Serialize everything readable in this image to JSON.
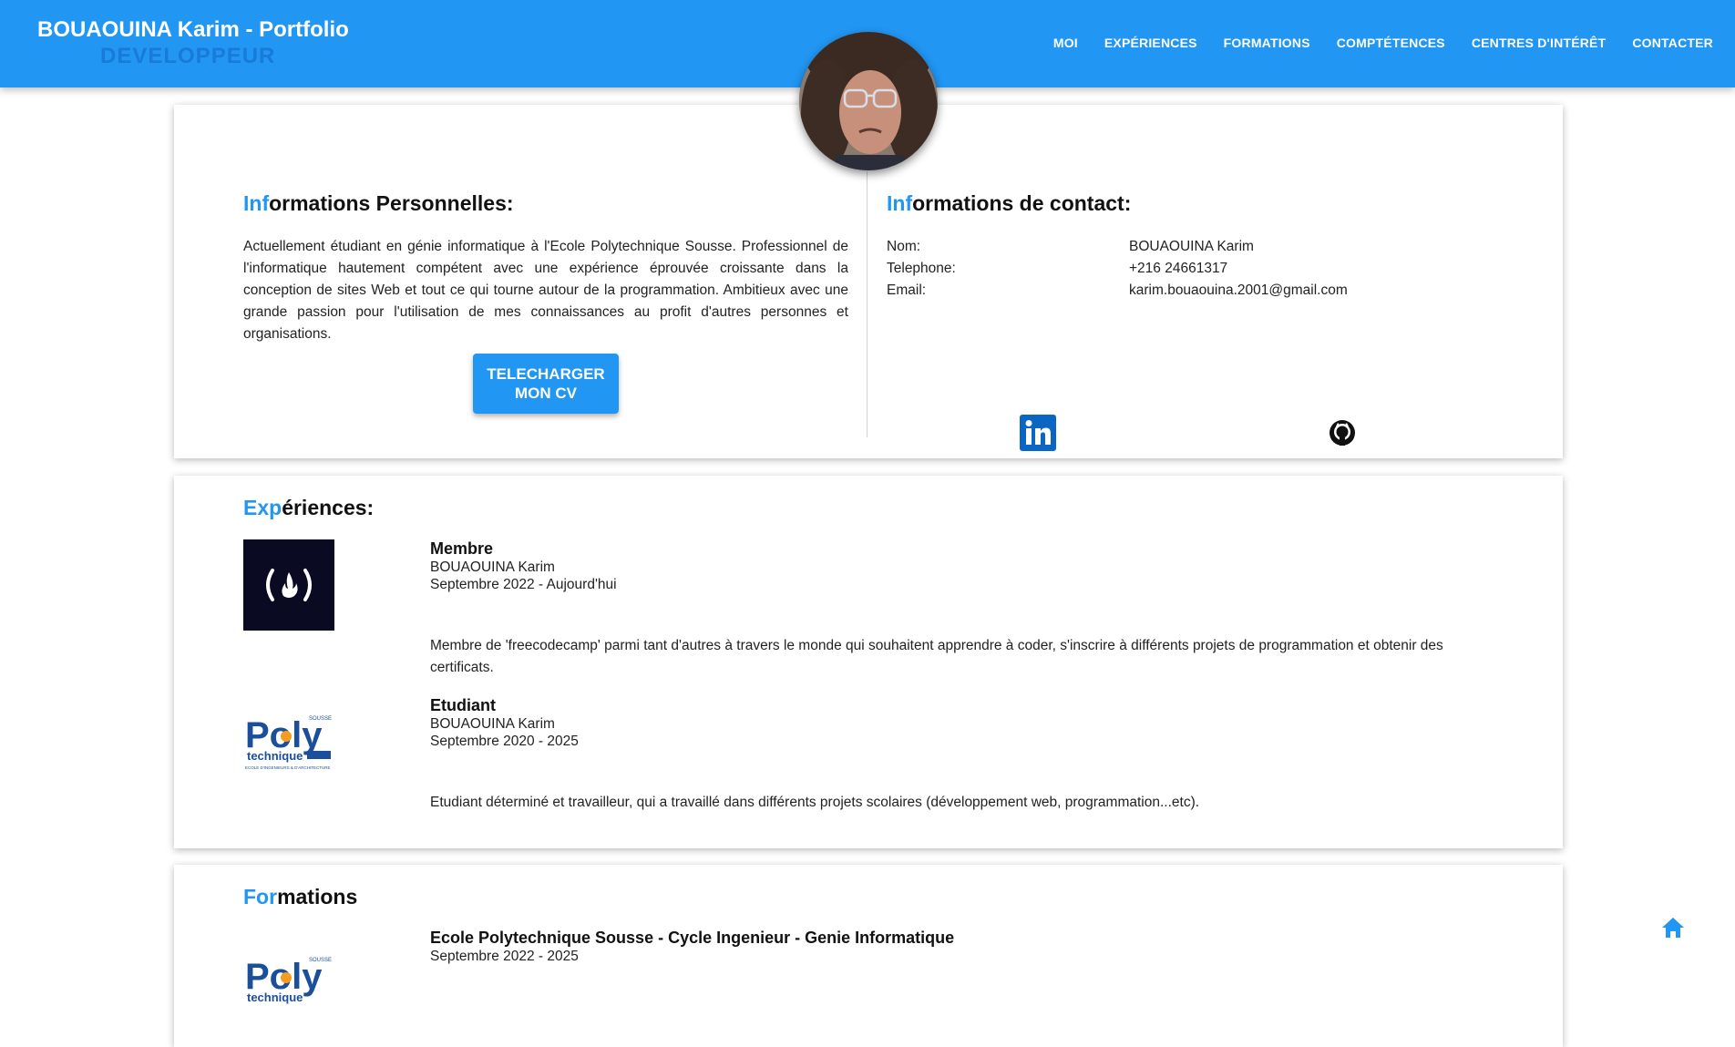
{
  "header": {
    "brand": "BOUAOUINA Karim - Portfolio",
    "subtitle": "DEVELOPPEUR",
    "nav": [
      "MOI",
      "EXPÉRIENCES",
      "FORMATIONS",
      "COMPTÉTENCES",
      "CENTRES D'INTÉRÊT",
      "CONTACTER"
    ]
  },
  "personal": {
    "title_hl": "Inf",
    "title_rest": "ormations Personnelles:",
    "about": "Actuellement étudiant en génie informatique à l'Ecole Polytechnique Sousse. Professionnel de l'informatique hautement compétent avec une expérience éprouvée croissante dans la conception de sites Web et tout ce qui tourne autour de la programmation. Ambitieux avec une grande passion pour l'utilisation de mes connaissances au profit d'autres personnes et organisations.",
    "cv_button": "TELECHARGER MON CV"
  },
  "contact": {
    "title_hl": "Inf",
    "title_rest": "ormations de contact:",
    "rows": [
      {
        "k": "Nom:",
        "v": "BOUAOUINA Karim"
      },
      {
        "k": "Telephone:",
        "v": "+216 24661317"
      },
      {
        "k": "Email:",
        "v": "karim.bouaouina.2001@gmail.com"
      }
    ]
  },
  "experiences": {
    "title_hl": "Exp",
    "title_rest": "ériences:",
    "items": [
      {
        "role": "Membre",
        "name": "BOUAOUINA Karim",
        "period": "Septembre 2022 - Aujourd'hui",
        "desc": "Membre de 'freecodecamp' parmi tant d'autres à travers le monde qui souhaitent apprendre à coder, s'inscrire à différents projets de programmation et obtenir des certificats.",
        "logo_text": "(🔥)"
      },
      {
        "role": "Etudiant",
        "name": "BOUAOUINA Karim",
        "period": "Septembre 2020 - 2025",
        "desc": "Etudiant déterminé et travailleur, qui a travaillé dans différents projets scolaires (développement web, programmation...etc).",
        "logo_text": "Poly"
      }
    ]
  },
  "formations": {
    "title_hl": "For",
    "title_rest": "mations",
    "items": [
      {
        "school": "Ecole Polytechnique Sousse - Cycle Ingenieur - Genie Informatique",
        "period": "Septembre 2022 - 2025",
        "logo_text": "Poly"
      }
    ]
  },
  "colors": {
    "accent": "#2196f3",
    "fcc_bg": "#0a0a23",
    "poly_blue": "#1b4f9c",
    "poly_orange": "#f39c1f"
  },
  "icons": [
    "linkedin-icon",
    "github-icon",
    "home-icon"
  ]
}
